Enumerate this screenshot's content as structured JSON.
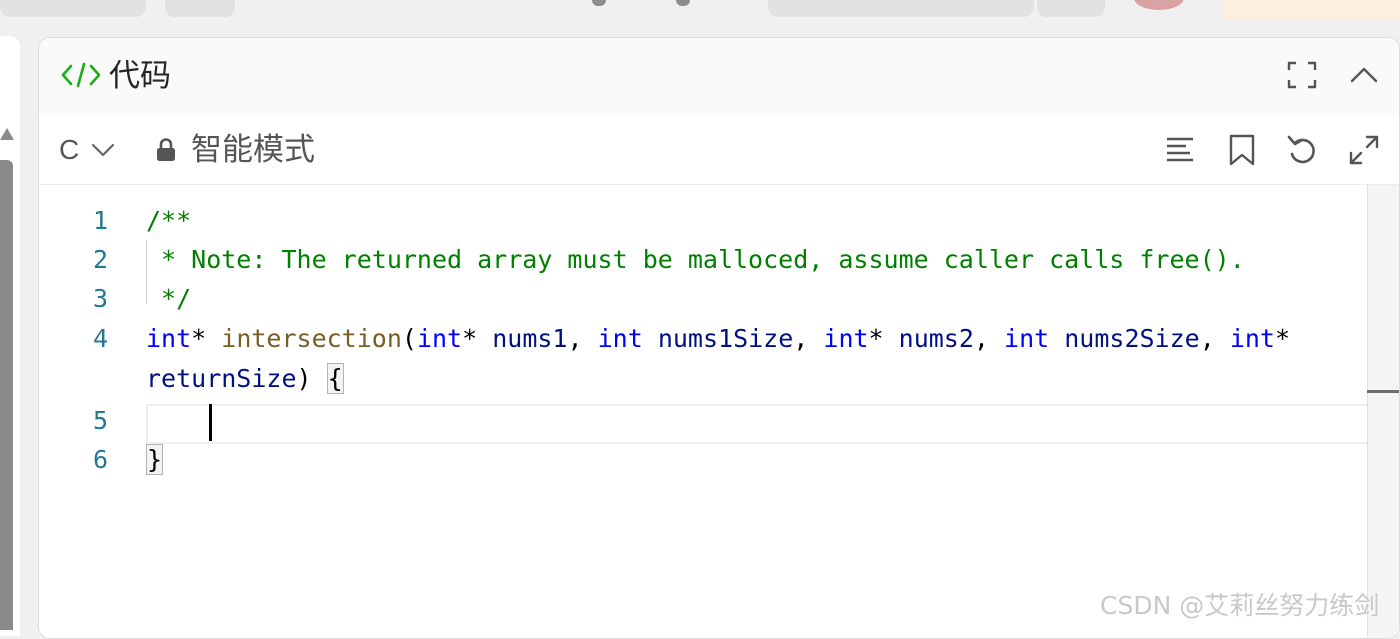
{
  "panel": {
    "title": "代码"
  },
  "toolbar": {
    "language": "C",
    "mode_label": "智能模式",
    "tools": [
      "format-icon",
      "bookmark-icon",
      "undo-icon",
      "expand-icon"
    ]
  },
  "editor": {
    "line_numbers": [
      "1",
      "2",
      "3",
      "4",
      "5",
      "6"
    ],
    "lines": {
      "l1_comment": "/**",
      "l2_comment": " * Note: The returned array must be malloced, assume caller calls free().",
      "l3_comment": " */",
      "l4_kw1": "int",
      "l4_star1": "* ",
      "l4_func": "intersection",
      "l4_paren": "(",
      "l4_kw2": "int",
      "l4_star2": "* ",
      "l4_p1": "nums1",
      "l4_comma1": ", ",
      "l4_kw3": "int",
      "l4_sp1": " ",
      "l4_p2": "nums1Size",
      "l4_comma2": ", ",
      "l4_kw4": "int",
      "l4_star3": "* ",
      "l4_p3": "nums2",
      "l4_comma3": ", ",
      "l4_kw5": "int",
      "l4_sp2": " ",
      "l4_p4": "nums2Size",
      "l4_comma4": ", ",
      "l4_kw6": "int",
      "l4_star4": "*",
      "l4b_p5": "returnSize",
      "l4b_close": ") ",
      "l4b_brace": "{",
      "l6_brace": "}"
    }
  },
  "watermark": "CSDN @艾莉丝努力练剑",
  "colors": {
    "comment": "#008000",
    "keyword": "#0000ff",
    "function": "#795e26",
    "parameter": "#001080",
    "line_number": "#237893",
    "header_icon": "#1aad19"
  }
}
